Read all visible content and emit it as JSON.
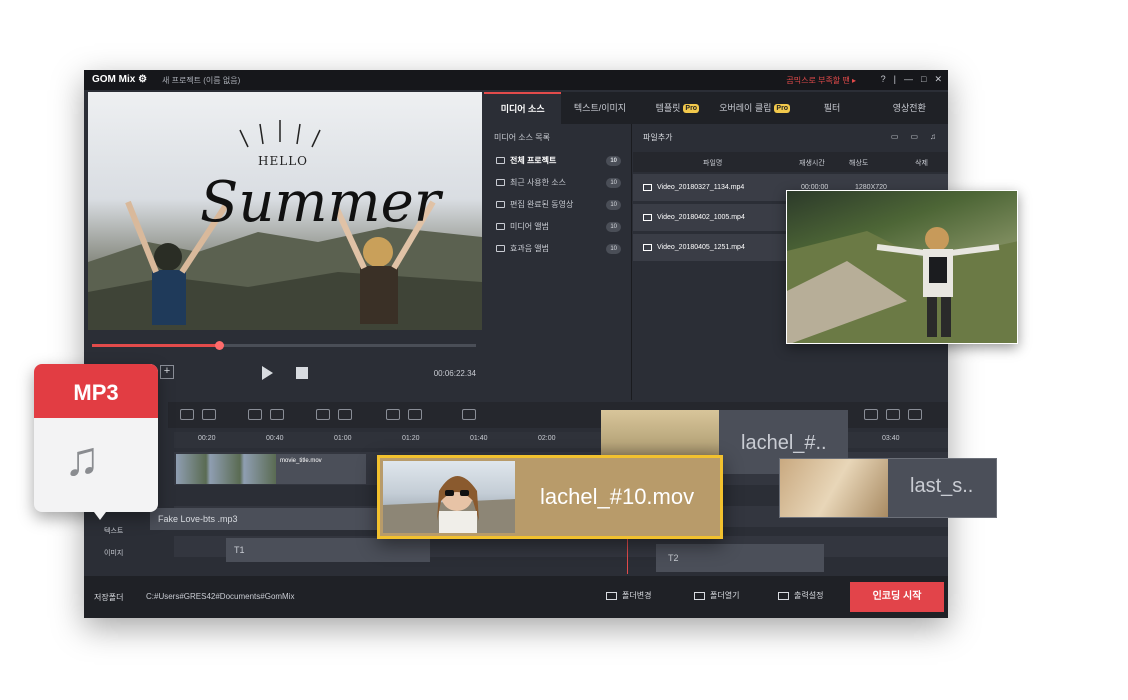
{
  "window": {
    "logo": "GOM Mix ⚙",
    "project_title": "새 프로젝트 (이름 없음)",
    "promo": "곰믹스로 부족할 땐 ▸",
    "controls": [
      "?",
      "|",
      "—",
      "□",
      "✕"
    ]
  },
  "preview": {
    "hello": "HELLO",
    "summer": "Summer",
    "timecode": "00:06:22.34",
    "progress": 0.33
  },
  "tabs": [
    {
      "label": "미디어 소스",
      "pro": ""
    },
    {
      "label": "텍스트/이미지",
      "pro": ""
    },
    {
      "label": "템플릿",
      "pro": "Pro"
    },
    {
      "label": "오버레이 클립",
      "pro": "Pro"
    },
    {
      "label": "필터",
      "pro": ""
    },
    {
      "label": "영상전환",
      "pro": ""
    }
  ],
  "sources": {
    "header": "미디어 소스 목록",
    "items": [
      {
        "label": "전체 프로젝트",
        "count": "10"
      },
      {
        "label": "최근 사용한 소스",
        "count": "10"
      },
      {
        "label": "편집 완료된 동영상",
        "count": "10"
      },
      {
        "label": "미디어 앨범",
        "count": "10"
      },
      {
        "label": "효과음 앨범",
        "count": "10"
      }
    ]
  },
  "files": {
    "add_label": "파일추가",
    "view_icons": [
      "▭",
      "▭",
      "♫"
    ],
    "columns": {
      "name": "파일명",
      "duration": "재생시간",
      "resolution": "해상도",
      "delete": "삭제"
    },
    "rows": [
      {
        "name": "Video_20180327_1134.mp4",
        "duration": "00:00:00",
        "resolution": "1280X720"
      },
      {
        "name": "Video_20180402_1005.mp4",
        "duration": "",
        "resolution": ""
      },
      {
        "name": "Video_20180405_1251.mp4",
        "duration": "",
        "resolution": ""
      }
    ]
  },
  "timeline": {
    "ruler": [
      "00:20",
      "00:40",
      "01:00",
      "01:20",
      "01:40",
      "02:00",
      "03:40"
    ],
    "video_clip": "movie_title.mov",
    "audio_clip": "Fake Love-bts .mp3",
    "text_clip1": "T1",
    "text_clip2": "T2",
    "track_labels": [
      "텍스트",
      "이미지"
    ]
  },
  "overlays": {
    "feature_clip": "lachel_#10.mov",
    "small_clip": "lachel_#..",
    "last_clip": "last_s..",
    "mp3_badge": "MP3",
    "note": "♫"
  },
  "bottombar": {
    "save_label": "저장폴더",
    "path": "C:#Users#GRES42#Documents#GomMix",
    "change_folder": "폴더변경",
    "open_folder": "폴더열기",
    "output_settings": "출력설정",
    "encode": "인코딩 시작"
  },
  "colors": {
    "accent": "#e2444a",
    "highlight": "#f2c12e",
    "panel": "#2b2e36"
  }
}
